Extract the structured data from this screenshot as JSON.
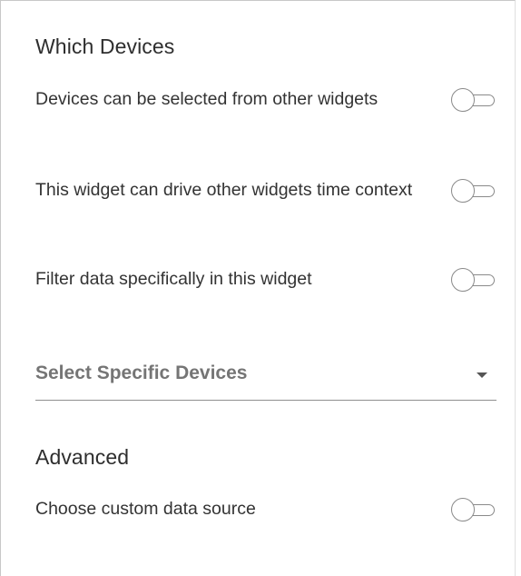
{
  "which_devices": {
    "title": "Which Devices",
    "options": [
      {
        "label": "Devices can be selected from other widgets",
        "enabled": false
      },
      {
        "label": "This widget can drive other widgets time context",
        "enabled": false
      },
      {
        "label": "Filter data specifically in this widget",
        "enabled": false
      }
    ],
    "select": {
      "placeholder": "Select Specific Devices",
      "icon": "caret-down-icon"
    }
  },
  "advanced": {
    "title": "Advanced",
    "options": [
      {
        "label": "Choose custom data source",
        "enabled": false
      }
    ]
  },
  "colors": {
    "text": "#333333",
    "muted": "#757575",
    "toggle_border": "#8a8a8a"
  }
}
